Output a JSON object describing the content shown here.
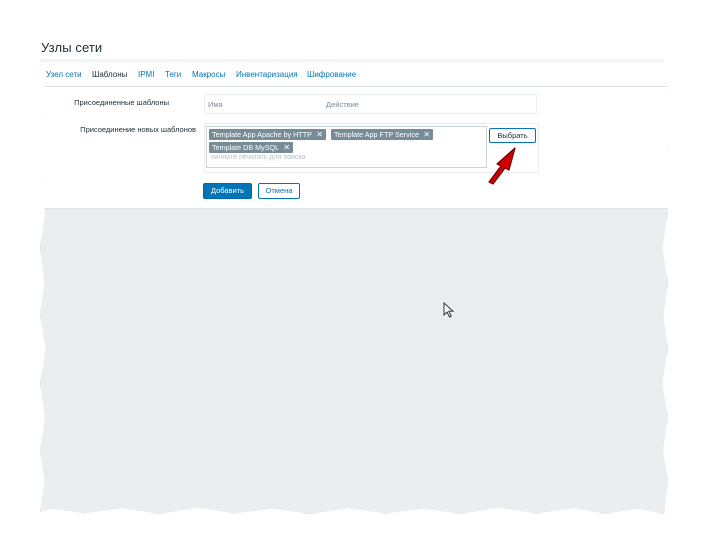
{
  "page": {
    "title": "Узлы сети"
  },
  "tabs": [
    {
      "label": "Узел сети",
      "active": false
    },
    {
      "label": "Шаблоны",
      "active": true
    },
    {
      "label": "IPMI",
      "active": false
    },
    {
      "label": "Теги",
      "active": false
    },
    {
      "label": "Макросы",
      "active": false
    },
    {
      "label": "Инвентаризация",
      "active": false
    },
    {
      "label": "Шифрование",
      "active": false
    }
  ],
  "form": {
    "linked_label": "Присоединенные шаблоны",
    "linked_columns": {
      "name": "Имя",
      "action": "Действие"
    },
    "link_new_label": "Присоединение новых шаблонов",
    "selected_templates": [
      "Template App Apache by HTTP",
      "Template App FTP Service",
      "Template DB MySQL"
    ],
    "search_placeholder": "начните печатать для поиска",
    "select_button": "Выбрать",
    "add_button": "Добавить",
    "cancel_button": "Отмена"
  },
  "colors": {
    "accent": "#0275b8",
    "chip": "#768d99",
    "annotation_arrow": "#cc0000"
  },
  "icons": {
    "chip_remove": "close-icon",
    "pointer": "mouse-cursor-icon",
    "annotation": "red-arrow-icon"
  }
}
